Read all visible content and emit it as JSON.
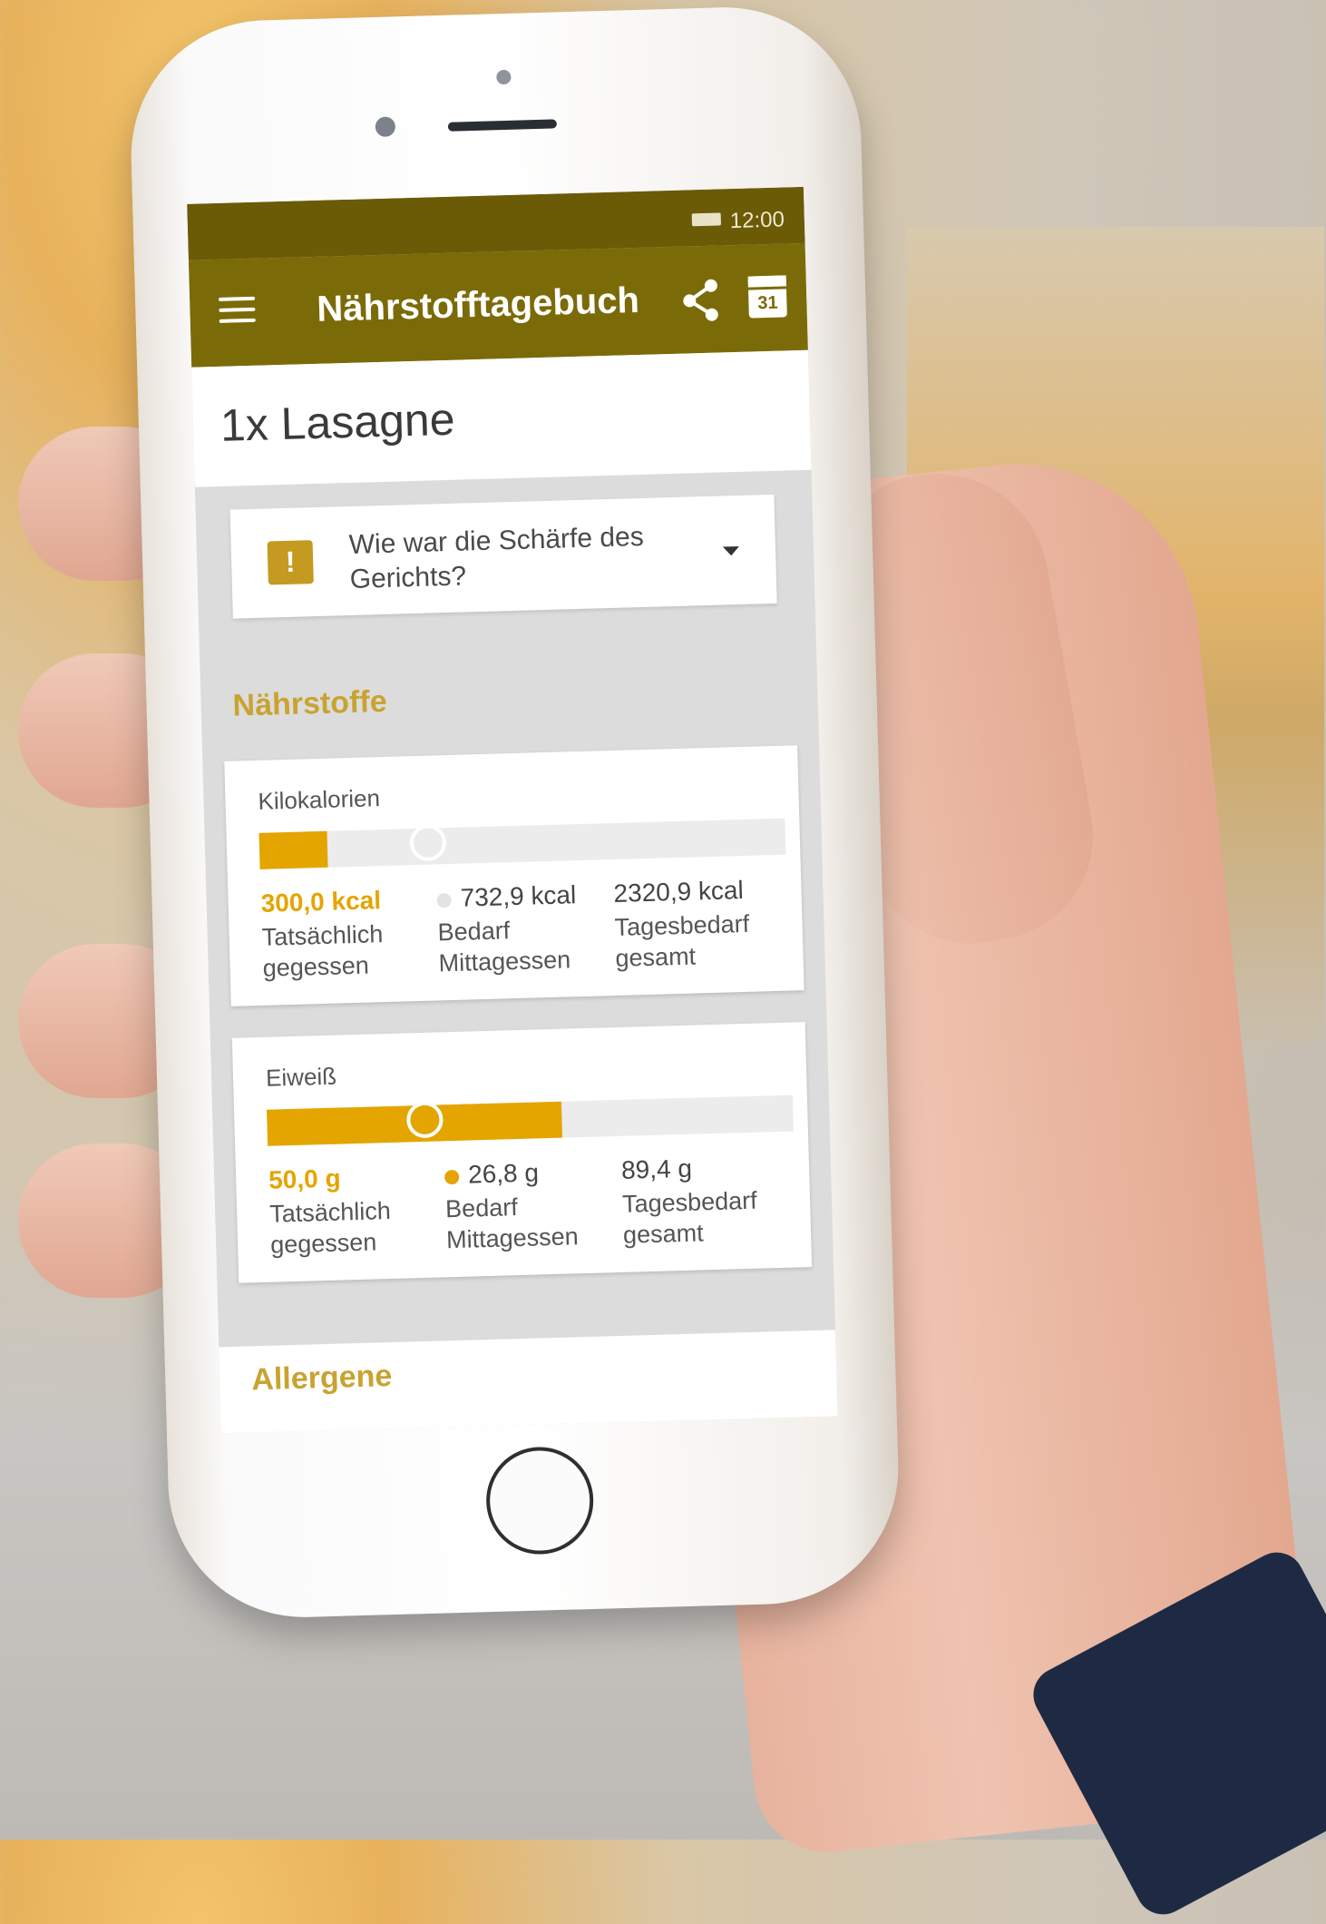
{
  "status_bar": {
    "time": "12:00"
  },
  "app_bar": {
    "title": "Nährstofftagebuch",
    "menu_icon": "menu-icon",
    "share_icon": "share-icon",
    "calendar_icon": "calendar-icon",
    "calendar_day": "31"
  },
  "dish": {
    "title": "1x Lasagne"
  },
  "spiciness_question": {
    "text": "Wie war die Schärfe des Gerichts?",
    "icon": "feedback-icon",
    "icon_glyph": "!"
  },
  "sections": {
    "nutrients_title": "Nährstoffe",
    "allergens_title": "Allergene"
  },
  "nutrients": [
    {
      "name": "Kilokalorien",
      "actual_value": "300,0 kcal",
      "actual_label": "Tatsächlich gegessen",
      "lunch_value": "732,9 kcal",
      "lunch_label": "Bedarf Mittagessen",
      "daily_value": "2320,9 kcal",
      "daily_label": "Tagesbedarf gesamt",
      "fill_fraction": 0.13,
      "marker_fraction": 0.32,
      "lunch_dot_color": "#e3e3e3"
    },
    {
      "name": "Eiweiß",
      "actual_value": "50,0 g",
      "actual_label": "Tatsächlich gegessen",
      "lunch_value": "26,8 g",
      "lunch_label": "Bedarf Mittagessen",
      "daily_value": "89,4 g",
      "daily_label": "Tagesbedarf gesamt",
      "fill_fraction": 0.56,
      "marker_fraction": 0.3,
      "lunch_dot_color": "#e4a500"
    }
  ],
  "colors": {
    "app_bar": "#7b6b08",
    "status_bar": "#6b5b06",
    "accent": "#e4a500",
    "section_title": "#c9a331"
  }
}
